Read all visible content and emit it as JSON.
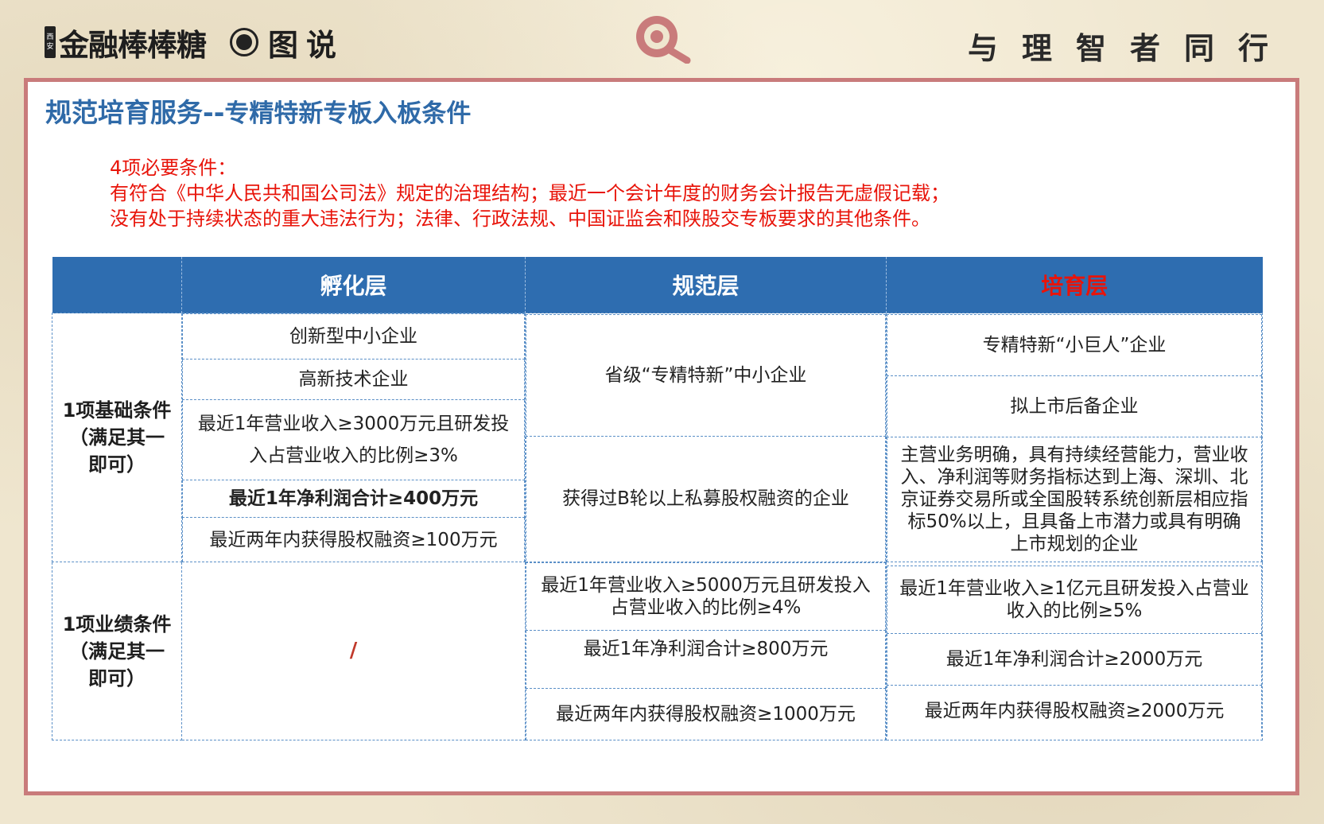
{
  "header": {
    "brand_badge_top": "西",
    "brand_badge_bottom": "安",
    "brand_name": "金融棒棒糖",
    "brand_sub": "图说",
    "slogan": "与理智者同行"
  },
  "slide": {
    "title_main": "规范培育服务",
    "title_sep": "--",
    "title_sub": "专精特新专板入板条件",
    "conditions": {
      "heading": "4项必要条件：",
      "line1": "有符合《中华人民共和国公司法》规定的治理结构；最近一个会计年度的财务会计报告无虚假记载；",
      "line2": "没有处于持续状态的重大违法行为；法律、行政法规、中国证监会和陕股交专板要求的其他条件。"
    }
  },
  "table": {
    "headers": [
      "",
      "孵化层",
      "规范层",
      "培育层"
    ],
    "basic": {
      "label_lines": [
        "1项基础条件",
        "（满足其一",
        "即可）"
      ],
      "incubation": [
        "创新型中小企业",
        "高新技术企业",
        "最近1年营业收入≥3000万元且研发投入占营业收入的比例≥3%",
        "最近1年净利润合计≥400万元",
        "最近两年内获得股权融资≥100万元"
      ],
      "standard": [
        "省级“专精特新”中小企业",
        "获得过B轮以上私募股权融资的企业"
      ],
      "cultivation": [
        "专精特新“小巨人”企业",
        "拟上市后备企业",
        "主营业务明确，具有持续经营能力，营业收入、净利润等财务指标达到上海、深圳、北京证券交易所或全国股转系统创新层相应指标50%以上，且具备上市潜力或具有明确上市规划的企业"
      ]
    },
    "performance": {
      "label_lines": [
        "1项业绩条件",
        "（满足其一",
        "即可）"
      ],
      "incubation": "/",
      "standard": [
        "最近1年营业收入≥5000万元且研发投入占营业收入的比例≥4%",
        "最近1年净利润合计≥800万元",
        "最近两年内获得股权融资≥1000万元"
      ],
      "cultivation": [
        "最近1年营业收入≥1亿元且研发投入占营业收入的比例≥5%",
        "最近1年净利润合计≥2000万元",
        "最近两年内获得股权融资≥2000万元"
      ]
    }
  },
  "colors": {
    "brand_blue": "#2e6db0",
    "title_blue": "#2f6aa8",
    "alert_red": "#e8140a",
    "frame_rose": "#c97b7b"
  },
  "icons": {
    "search": "magnifier-icon",
    "dot": "record-dot-icon"
  }
}
